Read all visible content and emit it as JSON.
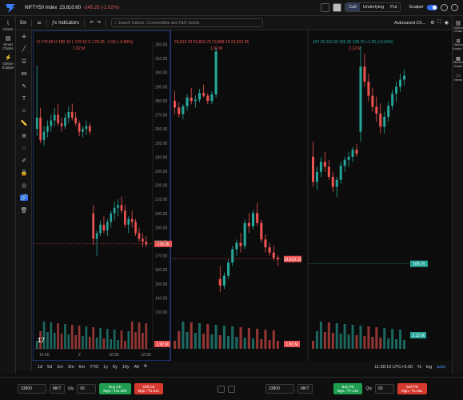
{
  "header": {
    "index_name": "NIFTY50 Index",
    "index_price": "23,810.60",
    "index_change": "-245.20 (-1.02%)",
    "segments": [
      "Call",
      "Underlying",
      "Put"
    ],
    "scalper_label": "Scalper"
  },
  "left_nav": [
    {
      "label": "Charts",
      "icon": "chart-icon"
    },
    {
      "label": "Smart Charts",
      "icon": "smart-chart-icon"
    },
    {
      "label": "Option Scalper",
      "icon": "option-scalper-icon"
    }
  ],
  "right_nav": [
    {
      "label": "Option Chain"
    },
    {
      "label": "Option Analyt..."
    },
    {
      "label": "Market Depth"
    },
    {
      "label": "News"
    }
  ],
  "toolbar": {
    "interval": "5m",
    "search_placeholder": "Search Indices, Commodities and F&O stocks",
    "indicators": "Indicators",
    "autosave": "Autosaved Ch..."
  },
  "chart_data": [
    {
      "type": "candlestick",
      "symbol": "NIFTY 08 Sep 26 23800 CE · 5 · NSE",
      "ohlc": "O 179.60  H 180.10  L 176.10  C 178.35  −1.55 (−0.86%)",
      "volume_label": "1.92 M",
      "y_ticks": [
        "320.00",
        "310.00",
        "300.00",
        "290.00",
        "280.00",
        "270.00",
        "260.00",
        "250.00",
        "240.00",
        "230.00",
        "220.00",
        "210.00",
        "200.00",
        "190.00",
        "180.00",
        "170.00",
        "160.00",
        "150.00",
        "140.00",
        "130.00"
      ],
      "ylim": [
        130,
        322
      ],
      "last_price": "178.35",
      "x_ticks": [
        "14:00",
        "2",
        "10:30",
        "12:00"
      ],
      "ohlc_series": [
        [
          260,
          305,
          255,
          268
        ],
        [
          268,
          275,
          250,
          252
        ],
        [
          252,
          262,
          248,
          258
        ],
        [
          258,
          266,
          254,
          262
        ],
        [
          262,
          270,
          258,
          266
        ],
        [
          266,
          275,
          262,
          270
        ],
        [
          270,
          278,
          262,
          264
        ],
        [
          264,
          268,
          258,
          262
        ],
        [
          262,
          271,
          260,
          268
        ],
        [
          268,
          276,
          264,
          272
        ],
        [
          272,
          278,
          266,
          268
        ],
        [
          268,
          272,
          262,
          264
        ],
        [
          264,
          266,
          255,
          258
        ],
        [
          258,
          262,
          254,
          260
        ],
        [
          260,
          266,
          256,
          262
        ],
        [
          262,
          264,
          256,
          258
        ],
        [
          200,
          206,
          178,
          182
        ],
        [
          182,
          188,
          170,
          186
        ],
        [
          186,
          195,
          184,
          192
        ],
        [
          192,
          198,
          186,
          188
        ],
        [
          188,
          196,
          184,
          194
        ],
        [
          194,
          202,
          190,
          200
        ],
        [
          200,
          208,
          195,
          204
        ],
        [
          204,
          210,
          198,
          206
        ],
        [
          206,
          212,
          200,
          202
        ],
        [
          202,
          206,
          190,
          192
        ],
        [
          192,
          198,
          186,
          196
        ],
        [
          196,
          202,
          190,
          194
        ],
        [
          194,
          196,
          184,
          186
        ],
        [
          186,
          190,
          180,
          182
        ],
        [
          182,
          186,
          176,
          180
        ],
        [
          180,
          184,
          176,
          178
        ]
      ]
    },
    {
      "type": "candlestick",
      "symbol": "NIFTY50 Index",
      "ohlc": "23,813.70  23,816.70  23,808.15  23,810.35",
      "volume_label": "1.92 M",
      "last_price": "23,810.35",
      "ylim": [
        23730,
        24140
      ],
      "ohlc_series": [
        [
          24050,
          24065,
          24030,
          24040
        ],
        [
          24040,
          24048,
          24025,
          24030
        ],
        [
          24030,
          24045,
          24022,
          24042
        ],
        [
          24042,
          24060,
          24035,
          24055
        ],
        [
          24055,
          24070,
          24045,
          24050
        ],
        [
          24050,
          24058,
          24040,
          24052
        ],
        [
          24052,
          24068,
          24048,
          24062
        ],
        [
          24062,
          24075,
          24055,
          24058
        ],
        [
          24058,
          24062,
          24045,
          24050
        ],
        [
          24050,
          24065,
          24045,
          24060
        ],
        [
          24060,
          24130,
          24055,
          24125
        ],
        [
          23780,
          23800,
          23760,
          23770
        ],
        [
          23770,
          23790,
          23765,
          23785
        ],
        [
          23785,
          23810,
          23780,
          23805
        ],
        [
          23805,
          23830,
          23800,
          23825
        ],
        [
          23825,
          23840,
          23815,
          23835
        ],
        [
          23835,
          23850,
          23820,
          23830
        ],
        [
          23830,
          23870,
          23825,
          23865
        ],
        [
          23865,
          23880,
          23850,
          23860
        ],
        [
          23860,
          23885,
          23855,
          23880
        ],
        [
          23880,
          23895,
          23860,
          23865
        ],
        [
          23865,
          23870,
          23835,
          23840
        ],
        [
          23840,
          23848,
          23820,
          23828
        ],
        [
          23828,
          23835,
          23815,
          23820
        ],
        [
          23820,
          23830,
          23808,
          23812
        ],
        [
          23812,
          23816,
          23800,
          23810
        ]
      ]
    },
    {
      "type": "candlestick",
      "symbol": "NIFTY 08 Sep 26 23800 PE",
      "ohlc": "107.35  110.90  106.35  108.15  +1.00 (+0.93%)",
      "volume_label": "2.12 M",
      "last_price": "108.15",
      "vol_price": "2.12 M",
      "ylim": [
        60,
        330
      ],
      "ohlc_series": [
        [
          215,
          230,
          185,
          190
        ],
        [
          190,
          205,
          182,
          200
        ],
        [
          200,
          215,
          195,
          210
        ],
        [
          210,
          220,
          200,
          205
        ],
        [
          205,
          212,
          192,
          195
        ],
        [
          195,
          200,
          180,
          185
        ],
        [
          185,
          195,
          175,
          192
        ],
        [
          192,
          210,
          188,
          206
        ],
        [
          206,
          215,
          200,
          212
        ],
        [
          212,
          220,
          205,
          215
        ],
        [
          215,
          225,
          210,
          222
        ],
        [
          222,
          228,
          215,
          218
        ],
        [
          240,
          325,
          230,
          305
        ],
        [
          305,
          318,
          285,
          290
        ],
        [
          290,
          298,
          270,
          276
        ],
        [
          276,
          284,
          260,
          265
        ],
        [
          265,
          275,
          250,
          258
        ],
        [
          258,
          268,
          238,
          245
        ],
        [
          245,
          260,
          238,
          255
        ],
        [
          255,
          270,
          250,
          266
        ],
        [
          266,
          282,
          262,
          278
        ],
        [
          278,
          290,
          270,
          285
        ],
        [
          285,
          298,
          280,
          292
        ],
        [
          292,
          302,
          286,
          296
        ]
      ]
    }
  ],
  "range_bar": {
    "ranges": [
      "1d",
      "5d",
      "1m",
      "3m",
      "6m",
      "YTD",
      "1y",
      "5y",
      "10y",
      "All"
    ],
    "clock": "11:38:19 UTC+5:30",
    "pct": "%",
    "log": "log",
    "auto": "auto"
  },
  "footer": {
    "strike_left": "23800",
    "strike_right": "23800",
    "mkt": "MKT",
    "qty_label": "Qty",
    "qty_left": "65",
    "qty_right": "65",
    "buy_ce": "Buy CE",
    "buy_ce_sub": "Mgn.: ₹11.59K",
    "sell_ce": "Sell CE",
    "sell_ce_sub": "Mgn.: ₹1.61L",
    "buy_pe": "Buy PE",
    "buy_pe_sub": "Mgn.: ₹7.11K",
    "sell_pe": "Sell PE",
    "sell_pe_sub": "Mgn.: ₹1.65L"
  },
  "colors": {
    "up": "#26a69a",
    "down": "#ef5350",
    "accent": "#2f6df6"
  }
}
